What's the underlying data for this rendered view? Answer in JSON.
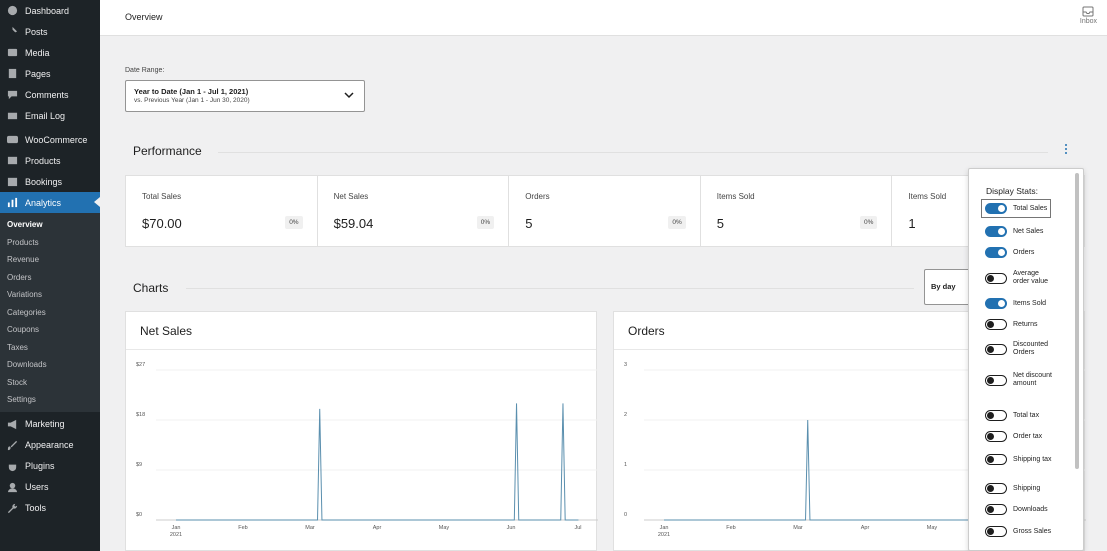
{
  "sidebar": {
    "top_items": [
      {
        "label": "Dashboard",
        "icon": "dashboard-icon"
      },
      {
        "label": "Posts",
        "icon": "pin-icon"
      },
      {
        "label": "Media",
        "icon": "media-icon"
      },
      {
        "label": "Pages",
        "icon": "pages-icon"
      },
      {
        "label": "Comments",
        "icon": "comments-icon"
      },
      {
        "label": "Email Log",
        "icon": "email-icon"
      }
    ],
    "woo_items": [
      {
        "label": "WooCommerce",
        "icon": "woocommerce-icon"
      },
      {
        "label": "Products",
        "icon": "products-icon"
      },
      {
        "label": "Bookings",
        "icon": "calendar-icon"
      },
      {
        "label": "Analytics",
        "icon": "analytics-icon"
      }
    ],
    "submenu": [
      "Overview",
      "Products",
      "Revenue",
      "Orders",
      "Variations",
      "Categories",
      "Coupons",
      "Taxes",
      "Downloads",
      "Stock",
      "Settings"
    ],
    "bottom_items": [
      {
        "label": "Marketing",
        "icon": "megaphone-icon"
      },
      {
        "label": "Appearance",
        "icon": "brush-icon"
      },
      {
        "label": "Plugins",
        "icon": "plug-icon"
      },
      {
        "label": "Users",
        "icon": "user-icon"
      },
      {
        "label": "Tools",
        "icon": "wrench-icon"
      }
    ]
  },
  "header": {
    "title": "Overview",
    "inbox_label": "Inbox"
  },
  "date_range": {
    "label": "Date Range:",
    "primary": "Year to Date (Jan 1 - Jul 1, 2021)",
    "secondary": "vs. Previous Year (Jan 1 - Jun 30, 2020)"
  },
  "performance": {
    "title": "Performance",
    "cards": [
      {
        "label": "Total Sales",
        "value": "$70.00",
        "delta": "0%"
      },
      {
        "label": "Net Sales",
        "value": "$59.04",
        "delta": "0%"
      },
      {
        "label": "Orders",
        "value": "5",
        "delta": "0%"
      },
      {
        "label": "Items Sold",
        "value": "5",
        "delta": "0%"
      },
      {
        "label": "Items Sold",
        "value": "1",
        "delta": ""
      }
    ]
  },
  "charts_section": {
    "title": "Charts",
    "interval": "By day"
  },
  "display_stats": {
    "header": "Display Stats:",
    "options": [
      {
        "label": "Total Sales",
        "on": true
      },
      {
        "label": "Net Sales",
        "on": true
      },
      {
        "label": "Orders",
        "on": true
      },
      {
        "label": "Average order value",
        "on": false
      },
      {
        "label": "Items Sold",
        "on": true
      },
      {
        "label": "Returns",
        "on": false
      },
      {
        "label": "Discounted Orders",
        "on": false
      },
      {
        "label": "Net discount amount",
        "on": false
      },
      {
        "label": "Total tax",
        "on": false
      },
      {
        "label": "Order tax",
        "on": false
      },
      {
        "label": "Shipping tax",
        "on": false
      },
      {
        "label": "Shipping",
        "on": false
      },
      {
        "label": "Downloads",
        "on": false
      },
      {
        "label": "Gross Sales",
        "on": false
      }
    ]
  },
  "colors": {
    "accent": "#2271b1",
    "sidebar_bg": "#1d2327",
    "line": "#5a8fae"
  },
  "chart_data": [
    {
      "type": "line",
      "title": "Net Sales",
      "y_ticks": [
        "$27",
        "$18",
        "$9",
        "$0"
      ],
      "x_ticks": [
        "Jan\n2021",
        "Feb",
        "Mar",
        "Apr",
        "May",
        "Jun",
        "Jul"
      ],
      "ylim": [
        0,
        27
      ],
      "series": [
        {
          "points": [
            [
              0,
              0
            ],
            [
              64,
              0
            ],
            [
              65,
              20
            ],
            [
              66,
              0
            ],
            [
              153,
              0
            ],
            [
              154,
              21
            ],
            [
              155,
              0
            ],
            [
              174,
              0
            ],
            [
              175,
              21
            ],
            [
              176,
              0
            ],
            [
              182,
              0
            ]
          ]
        }
      ]
    },
    {
      "type": "line",
      "title": "Orders",
      "y_ticks": [
        "3",
        "2",
        "1",
        "0"
      ],
      "x_ticks": [
        "Jan\n2021",
        "Feb",
        "Mar",
        "Apr",
        "May"
      ],
      "ylim": [
        0,
        3
      ],
      "series": [
        {
          "points": [
            [
              0,
              0
            ],
            [
              64,
              0
            ],
            [
              65,
              2
            ],
            [
              66,
              0
            ],
            [
              140,
              0
            ]
          ]
        }
      ]
    }
  ]
}
